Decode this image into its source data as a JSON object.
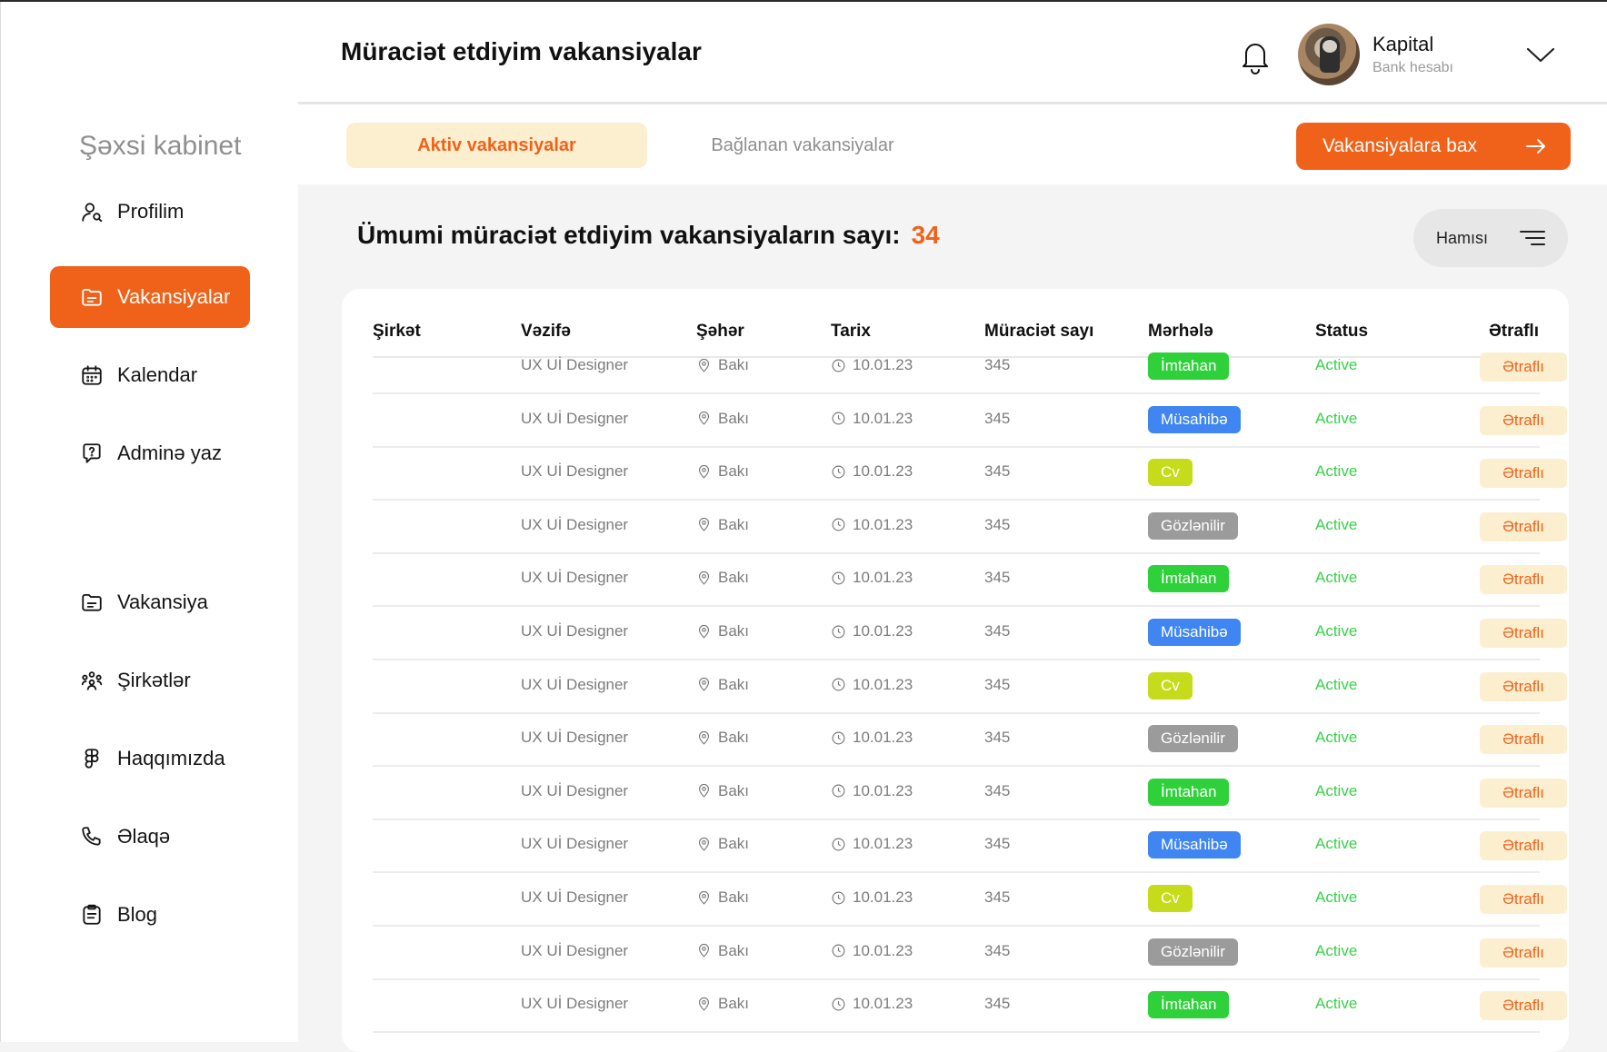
{
  "sidebar": {
    "title": "Şəxsi kabinet",
    "items": [
      {
        "label": "Profilim"
      },
      {
        "label": "Vakansiyalar"
      },
      {
        "label": "Kalendar"
      },
      {
        "label": "Adminə yaz"
      },
      {
        "label": "Vakansiya"
      },
      {
        "label": "Şirkətlər"
      },
      {
        "label": "Haqqımızda"
      },
      {
        "label": "Əlaqə"
      },
      {
        "label": "Blog"
      }
    ],
    "active_index": 1
  },
  "header": {
    "title": "Müraciət etdiyim vakansiyalar",
    "user_name": "Kapital",
    "user_sub": "Bank hesabı"
  },
  "tabs": {
    "active": "Aktiv vakansiyalar",
    "inactive": "Bağlanan vakansiyalar",
    "cta": "Vakansiyalara bax"
  },
  "summary": {
    "label": "Ümumi müraciət etdiyim vakansiyaların sayı:",
    "count": "34",
    "filter": "Hamısı"
  },
  "table": {
    "columns": [
      "Şirkət",
      "Vəzifə",
      "Şəhər",
      "Tarix",
      "Müraciət sayı",
      "Mərhələ",
      "Status",
      "Ətraflı"
    ],
    "stage_colors": {
      "İmtahan": "#2ED13A",
      "Müsahibə": "#3F86F2",
      "Cv": "#C6DC1B",
      "Gözlənilir": "#9B9B9B"
    },
    "rows": [
      {
        "company": "",
        "position": "UX Uİ Designer",
        "city": "Bakı",
        "date": "10.01.23",
        "applications": "345",
        "stage": "İmtahan",
        "status": "Active",
        "more": "Ətraflı"
      },
      {
        "company": "",
        "position": "UX Uİ Designer",
        "city": "Bakı",
        "date": "10.01.23",
        "applications": "345",
        "stage": "Müsahibə",
        "status": "Active",
        "more": "Ətraflı"
      },
      {
        "company": "",
        "position": "UX Uİ Designer",
        "city": "Bakı",
        "date": "10.01.23",
        "applications": "345",
        "stage": "Cv",
        "status": "Active",
        "more": "Ətraflı"
      },
      {
        "company": "",
        "position": "UX Uİ Designer",
        "city": "Bakı",
        "date": "10.01.23",
        "applications": "345",
        "stage": "Gözlənilir",
        "status": "Active",
        "more": "Ətraflı"
      },
      {
        "company": "",
        "position": "UX Uİ Designer",
        "city": "Bakı",
        "date": "10.01.23",
        "applications": "345",
        "stage": "İmtahan",
        "status": "Active",
        "more": "Ətraflı"
      },
      {
        "company": "",
        "position": "UX Uİ Designer",
        "city": "Bakı",
        "date": "10.01.23",
        "applications": "345",
        "stage": "Müsahibə",
        "status": "Active",
        "more": "Ətraflı"
      },
      {
        "company": "",
        "position": "UX Uİ Designer",
        "city": "Bakı",
        "date": "10.01.23",
        "applications": "345",
        "stage": "Cv",
        "status": "Active",
        "more": "Ətraflı"
      },
      {
        "company": "",
        "position": "UX Uİ Designer",
        "city": "Bakı",
        "date": "10.01.23",
        "applications": "345",
        "stage": "Gözlənilir",
        "status": "Active",
        "more": "Ətraflı"
      },
      {
        "company": "",
        "position": "UX Uİ Designer",
        "city": "Bakı",
        "date": "10.01.23",
        "applications": "345",
        "stage": "İmtahan",
        "status": "Active",
        "more": "Ətraflı"
      },
      {
        "company": "",
        "position": "UX Uİ Designer",
        "city": "Bakı",
        "date": "10.01.23",
        "applications": "345",
        "stage": "Müsahibə",
        "status": "Active",
        "more": "Ətraflı"
      },
      {
        "company": "",
        "position": "UX Uİ Designer",
        "city": "Bakı",
        "date": "10.01.23",
        "applications": "345",
        "stage": "Cv",
        "status": "Active",
        "more": "Ətraflı"
      },
      {
        "company": "",
        "position": "UX Uİ Designer",
        "city": "Bakı",
        "date": "10.01.23",
        "applications": "345",
        "stage": "Gözlənilir",
        "status": "Active",
        "more": "Ətraflı"
      },
      {
        "company": "",
        "position": "UX Uİ Designer",
        "city": "Bakı",
        "date": "10.01.23",
        "applications": "345",
        "stage": "İmtahan",
        "status": "Active",
        "more": "Ətraflı"
      }
    ]
  }
}
